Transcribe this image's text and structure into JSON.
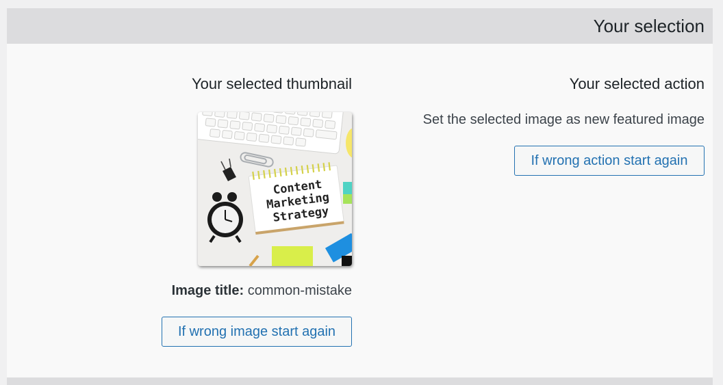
{
  "panel": {
    "title": "Your selection"
  },
  "thumbnail_section": {
    "heading": "Your selected thumbnail",
    "image": {
      "lettering_line1": "Content",
      "lettering_line2": "Marketing",
      "lettering_line3": "Strategy"
    },
    "image_title_label": "Image title:",
    "image_title_value": "common-mistake",
    "restart_button_label": "If wrong image start again"
  },
  "action_section": {
    "heading": "Your selected action",
    "description": "Set the selected image as new featured image",
    "restart_button_label": "If wrong action start again"
  },
  "colors": {
    "accent": "#2271b1",
    "header_bg": "#dcdcde",
    "panel_bg": "#f9f9f9"
  }
}
